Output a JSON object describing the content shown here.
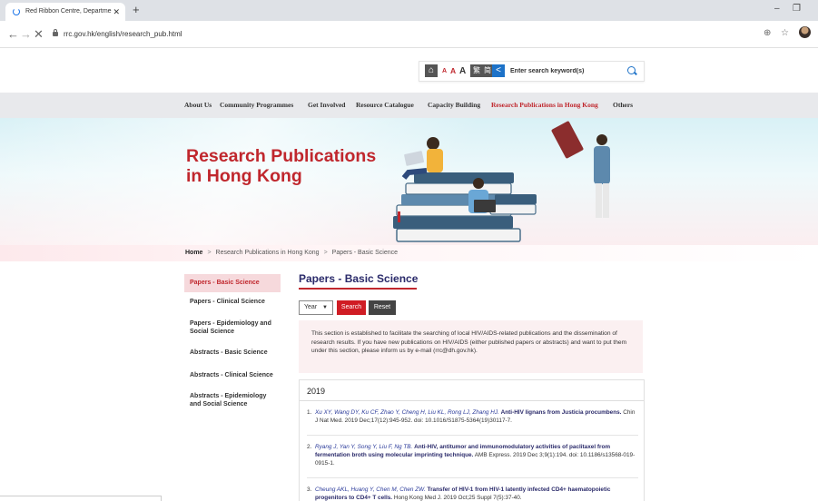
{
  "browser": {
    "tab_title": "Red Ribbon Centre, Departme",
    "url": "rrc.gov.hk/english/research_pub.html"
  },
  "a11y": {
    "font_small": "A",
    "font_medium": "A",
    "font_large": "A",
    "lang_trad": "繁",
    "lang_simp": "简",
    "search_placeholder": "Enter search keyword(s)"
  },
  "nav": {
    "items": [
      "About Us",
      "Community Programmes",
      "Get Involved",
      "Resource Catalogue",
      "Capacity Building",
      "Research Publications in Hong Kong",
      "Others"
    ]
  },
  "banner": {
    "title": "Research Publications in Hong Kong"
  },
  "breadcrumb": {
    "home": "Home",
    "level1": "Research Publications in Hong Kong",
    "level2": "Papers - Basic Science"
  },
  "sidebar": {
    "items": [
      "Papers - Basic Science",
      "Papers - Clinical Science",
      "Papers - Epidemiology and Social Science",
      "Abstracts - Basic Science",
      "Abstracts - Clinical Science",
      "Abstracts - Epidemiology and Social Science"
    ]
  },
  "content": {
    "title": "Papers - Basic Science",
    "year_select": "Year",
    "search_button": "Search",
    "reset_button": "Reset",
    "intro": "This section is established to facilitate the searching of local HIV/AIDS-related publications and the dissemination of research results. If you have new publications on HIV/AIDS (either published papers or abstracts) and want to put them under this section, please inform us by e-mail (rrc@dh.gov.hk).",
    "year_heading": "2019",
    "publications": [
      {
        "num": "1.",
        "authors": "Xu XY, Wang DY, Ku CF, Zhao Y, Cheng H, Liu KL, Rong LJ, Zhang HJ.",
        "title": "Anti-HIV lignans from Justicia procumbens.",
        "citation": "Chin J Nat Med. 2019 Dec;17(12):945-952. doi: 10.1016/S1875-5364(19)30117-7."
      },
      {
        "num": "2.",
        "authors": "Ryang J, Yan Y, Song Y, Liu F, Ng TB.",
        "title": "Anti-HIV, antitumor and immunomodulatory activities of paclitaxel from fermentation broth using molecular imprinting technique.",
        "citation": "AMB Express. 2019 Dec 3;9(1):194. doi: 10.1186/s13568-019-0915-1."
      },
      {
        "num": "3.",
        "authors": "Cheung AKL, Huang Y, Chen M, Chen ZW.",
        "title": "Transfer of HIV-1 from HIV-1 latently infected CD4+ haematopoietic progenitors to CD4+ T cells.",
        "citation": "Hong Kong Med J. 2019 Oct;25 Suppl 7(5):37-40."
      }
    ]
  },
  "colors": {
    "brand_red": "#c0272d",
    "nav_bg": "#e8e9ec",
    "title_navy": "#2a2a6a"
  }
}
